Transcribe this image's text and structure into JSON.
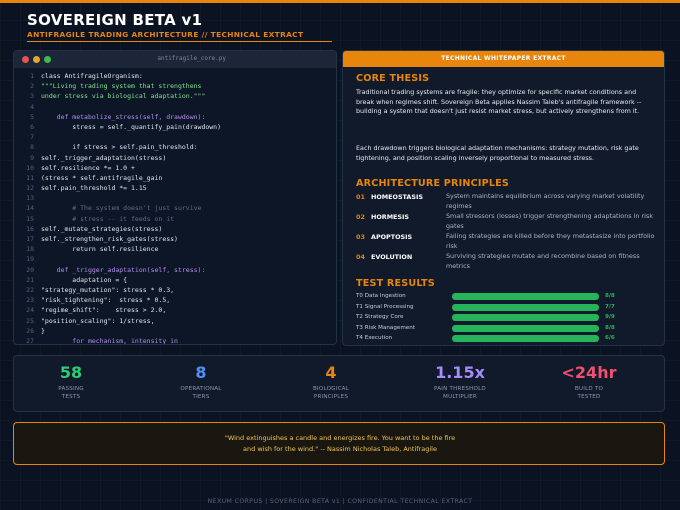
{
  "header": {
    "title": "SOVEREIGN BETA v1",
    "subtitle": "ANTIFRAGILE TRADING ARCHITECTURE  //  TECHNICAL EXTRACT"
  },
  "code": {
    "filename": "antifragile_core.py",
    "lines": [
      {
        "n": "1",
        "t": "class AntifragileOrganism:",
        "k": "fn"
      },
      {
        "n": "2",
        "t": "\"\"\"Living trading system that strengthens",
        "k": "str"
      },
      {
        "n": "3",
        "t": "under stress via biological adaptation.\"\"\"",
        "k": "str"
      },
      {
        "n": "4",
        "t": "",
        "k": "fn"
      },
      {
        "n": "5",
        "t": "    def metabolize_stress(self, drawdown):",
        "k": "kw"
      },
      {
        "n": "6",
        "t": "        stress = self._quantify_pain(drawdown)",
        "k": "fn"
      },
      {
        "n": "7",
        "t": "",
        "k": "fn"
      },
      {
        "n": "8",
        "t": "        if stress > self.pain_threshold:",
        "k": "fn"
      },
      {
        "n": "9",
        "t": "self._trigger_adaptation(stress)",
        "k": "fn"
      },
      {
        "n": "10",
        "t": "self.resilience *= 1.0 +",
        "k": "fn"
      },
      {
        "n": "11",
        "t": "(stress * self.antifragile_gain",
        "k": "fn"
      },
      {
        "n": "12",
        "t": "self.pain_threshold *= 1.15",
        "k": "fn"
      },
      {
        "n": "13",
        "t": "",
        "k": "fn"
      },
      {
        "n": "14",
        "t": "        # The system doesn't just survive",
        "k": "cm"
      },
      {
        "n": "15",
        "t": "        # stress -- it feeds on it",
        "k": "cm"
      },
      {
        "n": "16",
        "t": "self._mutate_strategies(stress)",
        "k": "fn"
      },
      {
        "n": "17",
        "t": "self._strengthen_risk_gates(stress)",
        "k": "fn"
      },
      {
        "n": "18",
        "t": "        return self.resilience",
        "k": "fn"
      },
      {
        "n": "19",
        "t": "",
        "k": "fn"
      },
      {
        "n": "20",
        "t": "    def _trigger_adaptation(self, stress):",
        "k": "kw"
      },
      {
        "n": "21",
        "t": "        adaptation = {",
        "k": "fn"
      },
      {
        "n": "22",
        "t": "\"strategy_mutation\": stress * 0.3,",
        "k": "fn"
      },
      {
        "n": "23",
        "t": "\"risk_tightening\":  stress * 0.5,",
        "k": "fn"
      },
      {
        "n": "24",
        "t": "\"regime_shift\":    stress > 2.0,",
        "k": "fn"
      },
      {
        "n": "25",
        "t": "\"position_scaling\": 1/stress,",
        "k": "fn"
      },
      {
        "n": "26",
        "t": "}",
        "k": "fn"
      },
      {
        "n": "27",
        "t": "        for mechanism, intensity in",
        "k": "kw"
      },
      {
        "n": "28",
        "t": "adaptation.items():",
        "k": "fn"
      },
      {
        "n": "29",
        "t": "self._apply(mechanism, intensity)",
        "k": "fn"
      }
    ]
  },
  "paper": {
    "header": "TECHNICAL WHITEPAPER EXTRACT",
    "core_title": "CORE THESIS",
    "core_p1": "Traditional trading systems are fragile: they optimize for specific market conditions and break when regimes shift. Sovereign Beta applies Nassim Taleb's antifragile framework -- building a system that doesn't just resist market stress, but actively strengthens from it.",
    "core_p2": "Each drawdown triggers biological adaptation mechanisms: strategy mutation, risk gate tightening, and position scaling inversely proportional to measured stress.",
    "arch_title": "ARCHITECTURE PRINCIPLES",
    "principles": [
      {
        "num": "01",
        "name": "HOMEOSTASIS",
        "desc": "System maintains equilibrium across varying market volatility regimes"
      },
      {
        "num": "02",
        "name": "HORMESIS",
        "desc": "Small stressors (losses) trigger strengthening adaptations in risk gates"
      },
      {
        "num": "03",
        "name": "APOPTOSIS",
        "desc": "Failing strategies are killed before they metastasize into portfolio risk"
      },
      {
        "num": "04",
        "name": "EVOLUTION",
        "desc": "Surviving strategies mutate and recombine based on fitness metrics"
      }
    ],
    "tests_title": "TEST RESULTS",
    "tests": [
      {
        "name": "T0 Data Ingestion",
        "score": "8/8",
        "fill": 1.0
      },
      {
        "name": "T1 Signal Processing",
        "score": "7/7",
        "fill": 1.0
      },
      {
        "name": "T2 Strategy Core",
        "score": "9/9",
        "fill": 1.0
      },
      {
        "name": "T3 Risk Management",
        "score": "8/8",
        "fill": 1.0
      },
      {
        "name": "T4 Execution",
        "score": "6/6",
        "fill": 1.0
      },
      {
        "name": "T5 Analytics",
        "score": "7/7",
        "fill": 1.0
      }
    ]
  },
  "stats": [
    {
      "value": "58",
      "label1": "PASSING",
      "label2": "TESTS",
      "color": "#2ecc71"
    },
    {
      "value": "8",
      "label1": "OPERATIONAL",
      "label2": "TIERS",
      "color": "#4f8ff7"
    },
    {
      "value": "4",
      "label1": "BIOLOGICAL",
      "label2": "PRINCIPLES",
      "color": "#e8850c"
    },
    {
      "value": "1.15x",
      "label1": "PAIN THRESHOLD",
      "label2": "MULTIPLIER",
      "color": "#a78bfa"
    },
    {
      "value": "<24hr",
      "label1": "BUILD TO",
      "label2": "TESTED",
      "color": "#f0506e"
    }
  ],
  "quote": {
    "line1": "\"Wind extinguishes a candle and energizes fire. You want to be the fire",
    "line2": "and wish for the wind.\"  --  Nassim Nicholas Taleb, Antifragile"
  },
  "footer": "NEXUM CORPUS  |  SOVEREIGN BETA v1  |  CONFIDENTIAL TECHNICAL EXTRACT"
}
